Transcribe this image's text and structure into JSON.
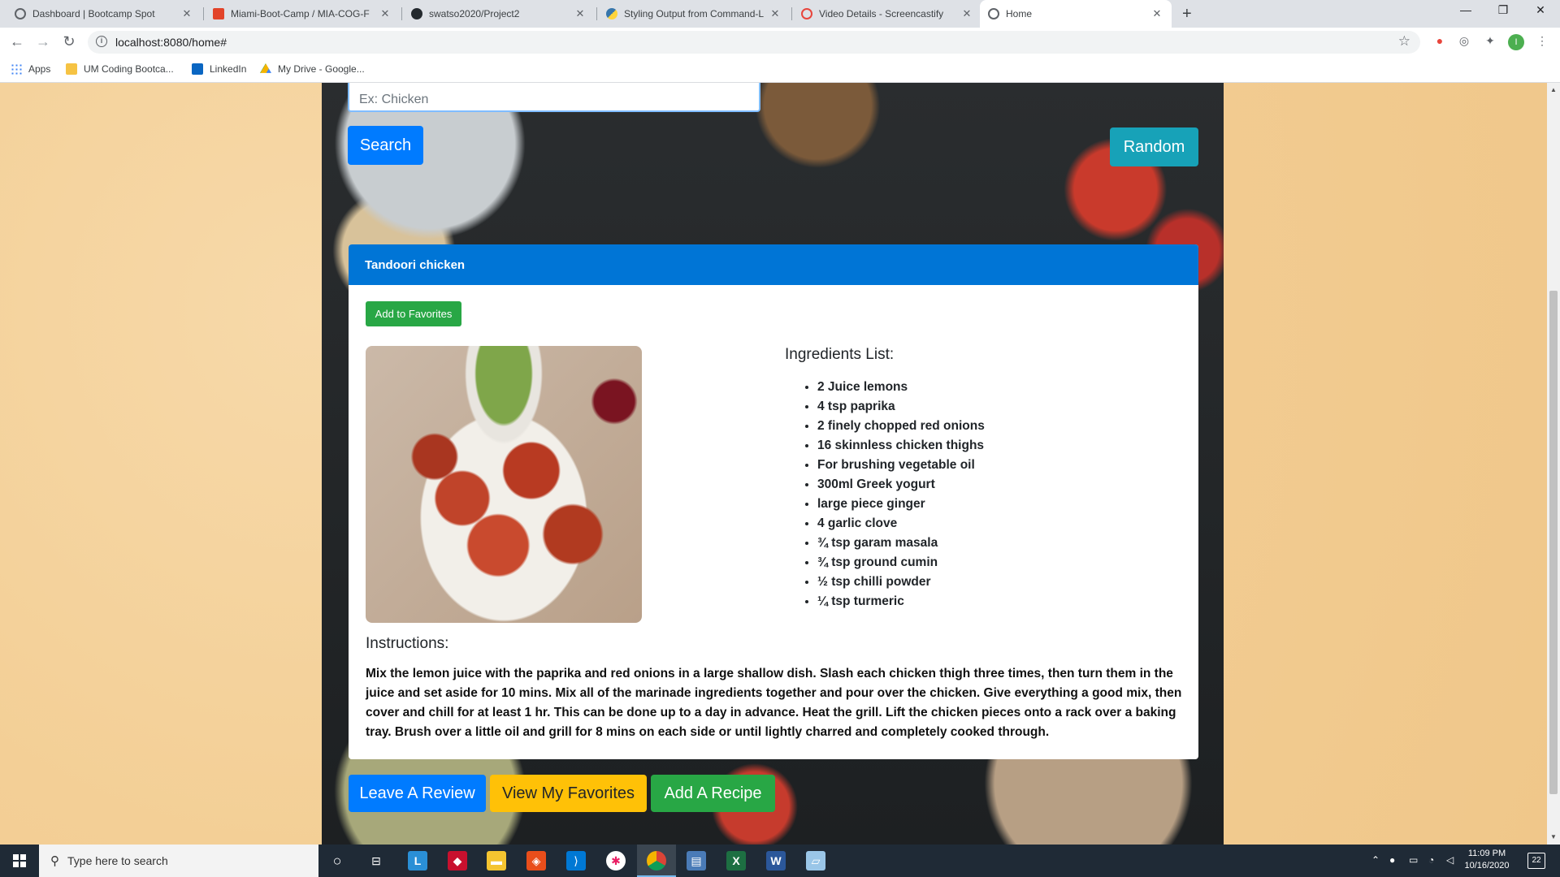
{
  "browser": {
    "tabs": [
      {
        "title": "Dashboard | Bootcamp Spot",
        "icon": "globe-icon"
      },
      {
        "title": "Miami-Boot-Camp / MIA-COG-F",
        "icon": "gitlab-icon"
      },
      {
        "title": "swatso2020/Project2",
        "icon": "github-icon"
      },
      {
        "title": "Styling Output from Command-L",
        "icon": "python-icon"
      },
      {
        "title": "Video Details - Screencastify",
        "icon": "screencastify-icon"
      },
      {
        "title": "Home",
        "icon": "globe-icon"
      }
    ],
    "url": "localhost:8080/home#",
    "bookmarks": [
      {
        "label": "Apps",
        "icon": "apps-grid-icon"
      },
      {
        "label": "UM Coding Bootca...",
        "icon": "folder-icon"
      },
      {
        "label": "LinkedIn",
        "icon": "linkedin-icon"
      },
      {
        "label": "My Drive - Google...",
        "icon": "google-drive-icon"
      }
    ],
    "profile_initial": "I"
  },
  "page": {
    "search_placeholder": "Ex: Chicken",
    "search_button": "Search",
    "random_button": "Random",
    "recipe": {
      "title": "Tandoori chicken",
      "favorite_button": "Add to Favorites",
      "ingredients_title": "Ingredients List:",
      "ingredients": [
        "2 Juice lemons",
        "4 tsp paprika",
        "2 finely chopped red onions",
        "16 skinnless chicken thighs",
        "For brushing vegetable oil",
        "300ml Greek yogurt",
        "large piece ginger",
        "4 garlic clove",
        "¾ tsp garam masala",
        "¾ tsp ground cumin",
        "½ tsp chilli powder",
        "¼ tsp turmeric"
      ],
      "instructions_title": "Instructions:",
      "instructions": "Mix the lemon juice with the paprika and red onions in a large shallow dish. Slash each chicken thigh three times, then turn them in the juice and set aside for 10 mins. Mix all of the marinade ingredients together and pour over the chicken. Give everything a good mix, then cover and chill for at least 1 hr. This can be done up to a day in advance. Heat the grill. Lift the chicken pieces onto a rack over a baking tray. Brush over a little oil and grill for 8 mins on each side or until lightly charred and completely cooked through."
    },
    "bottom_buttons": {
      "review": "Leave A Review",
      "favorites": "View My Favorites",
      "add_recipe": "Add A Recipe"
    }
  },
  "taskbar": {
    "search_placeholder": "Type here to search",
    "time": "11:09 PM",
    "date": "10/16/2020",
    "notifications": "22"
  },
  "colors": {
    "primary": "#007bff",
    "info": "#17a2b8",
    "success": "#28a745",
    "warning": "#ffc107",
    "card_header": "#0075d6"
  }
}
